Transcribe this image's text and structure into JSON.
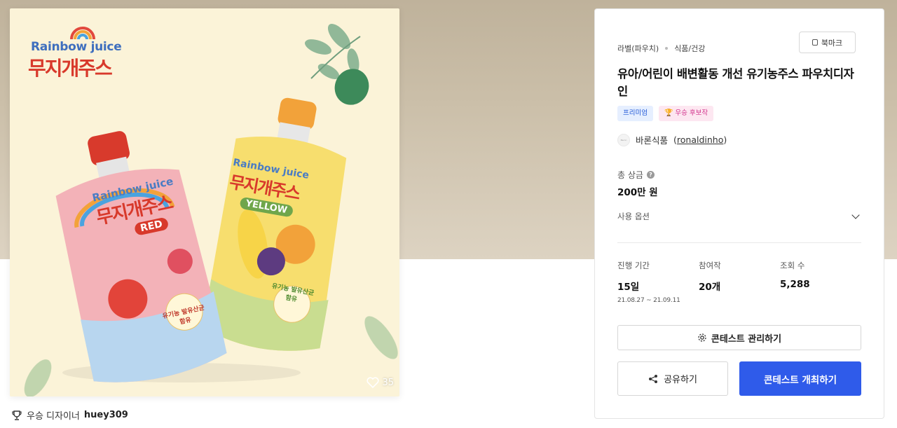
{
  "artwork": {
    "brand_en": "Rainbow juice",
    "brand_ko": "무지개주스",
    "pouch_red": {
      "en": "Rainbow juice",
      "ko": "무지개주스",
      "tag": "RED",
      "badge": "유기농 발유산균 함유"
    },
    "pouch_yellow": {
      "en": "Rainbow juice",
      "ko": "무지개주스",
      "tag": "YELLOW",
      "badge": "유기농 발유산균 함유"
    },
    "like_count": "35"
  },
  "winner": {
    "label": "우승 디자이너",
    "username": "huey309"
  },
  "panel": {
    "bookmark_label": "북마크",
    "breadcrumbs": [
      "라벨(파우치)",
      "식품/건강"
    ],
    "title": "유아/어린이 배변활동 개선 유기농주스 파우치디자인",
    "badges": {
      "premium": "프리미엄",
      "candidate": "우승 후보작"
    },
    "host": {
      "name": "바론식품",
      "handle": "ronaldinho",
      "avatar_text": "Baron"
    },
    "prize": {
      "label": "총 상금",
      "value": "200만 원"
    },
    "usage_label": "사용 옵션",
    "stats": {
      "period": {
        "label": "진행 기간",
        "value": "15일",
        "range": "21.08.27 ~ 21.09.11"
      },
      "entries": {
        "label": "참여작",
        "value": "20개"
      },
      "views": {
        "label": "조회 수",
        "value": "5,288"
      }
    },
    "manage_label": "콘테스트 관리하기",
    "share_label": "공유하기",
    "host_contest_label": "콘테스트 개최하기"
  },
  "colors": {
    "primary": "#2f5bea",
    "premium_bg": "#e6efff",
    "candidate_bg": "#fde7f1"
  }
}
